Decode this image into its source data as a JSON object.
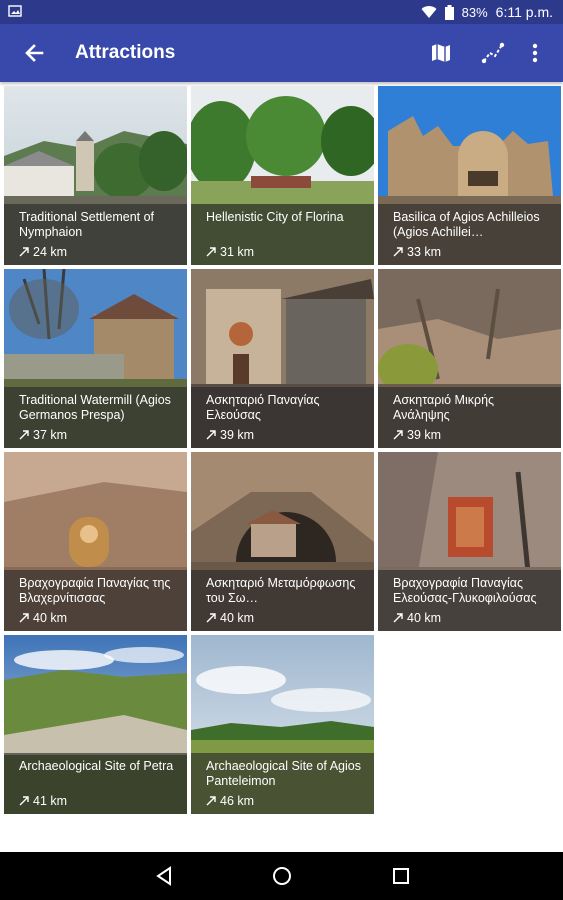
{
  "status_bar": {
    "battery": "83%",
    "time": "6:11 p.m."
  },
  "app_bar": {
    "title": "Attractions"
  },
  "tiles": [
    {
      "name": "Traditional Settlement of Nymphaion",
      "distance": "24 km"
    },
    {
      "name": "Hellenistic City of Florina",
      "distance": "31 km"
    },
    {
      "name": "Basilica of Agios Achilleios (Agios Achillei…",
      "distance": "33 km"
    },
    {
      "name": "Traditional Watermill (Agios Germanos Prespa)",
      "distance": "37 km"
    },
    {
      "name": "Ασκηταριό Παναγίας Ελεούσας",
      "distance": "39 km"
    },
    {
      "name": "Ασκηταριό Μικρής Ανάληψης",
      "distance": "39 km"
    },
    {
      "name": "Βραχογραφία Παναγίας της Βλαχερνίτισσας",
      "distance": "40 km"
    },
    {
      "name": "Ασκηταριό Μεταμόρφωσης του Σω…",
      "distance": "40 km"
    },
    {
      "name": "Βραχογραφία Παναγίας Ελεούσας-Γλυκοφιλούσας",
      "distance": "40 km"
    },
    {
      "name": "Archaeological Site of Petra",
      "distance": "41 km"
    },
    {
      "name": "Archaeological Site of Agios Panteleimon",
      "distance": "46 km"
    }
  ],
  "colors": {
    "status_bar": "#2d3a8c",
    "app_bar": "#3949ab",
    "caption_overlay": "#282828",
    "nav_bar": "#000000"
  }
}
